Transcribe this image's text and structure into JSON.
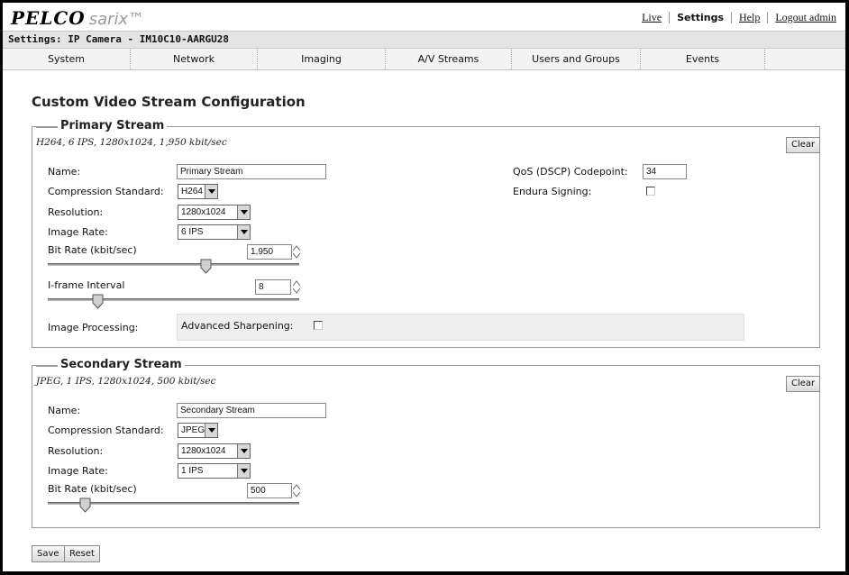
{
  "header": {
    "logo_brand": "PELCO",
    "logo_product": "sarix™",
    "links": {
      "live": "Live",
      "settings": "Settings",
      "help": "Help",
      "logout": "Logout admin"
    }
  },
  "breadcrumb": "Settings: IP Camera - IM10C10-AARGU28",
  "nav": [
    "System",
    "Network",
    "Imaging",
    "A/V Streams",
    "Users and Groups",
    "Events"
  ],
  "page_title": "Custom Video Stream Configuration",
  "labels": {
    "name": "Name:",
    "compression": "Compression Standard:",
    "resolution": "Resolution:",
    "image_rate": "Image Rate:",
    "bit_rate": "Bit Rate (kbit/sec)",
    "iframe": "I-frame Interval",
    "image_processing": "Image Processing:",
    "advanced_sharpening": "Advanced Sharpening:",
    "qos": "QoS (DSCP) Codepoint:",
    "endura": "Endura Signing:",
    "clear": "Clear"
  },
  "primary": {
    "legend": "Primary Stream",
    "summary": "H264, 6 IPS, 1280x1024, 1,950 kbit/sec",
    "name": "Primary Stream",
    "compression": "H264",
    "resolution": "1280x1024",
    "image_rate": "6 IPS",
    "bit_rate": "1,950",
    "bit_rate_slider_fraction": 0.63,
    "iframe": "8",
    "iframe_slider_fraction": 0.2,
    "qos": "34",
    "endura_signing": false,
    "advanced_sharpening": false
  },
  "secondary": {
    "legend": "Secondary Stream",
    "summary": "JPEG, 1 IPS, 1280x1024, 500 kbit/sec",
    "name": "Secondary Stream",
    "compression": "JPEG",
    "resolution": "1280x1024",
    "image_rate": "1 IPS",
    "bit_rate": "500",
    "bit_rate_slider_fraction": 0.15
  },
  "buttons": {
    "save": "Save",
    "reset": "Reset"
  }
}
